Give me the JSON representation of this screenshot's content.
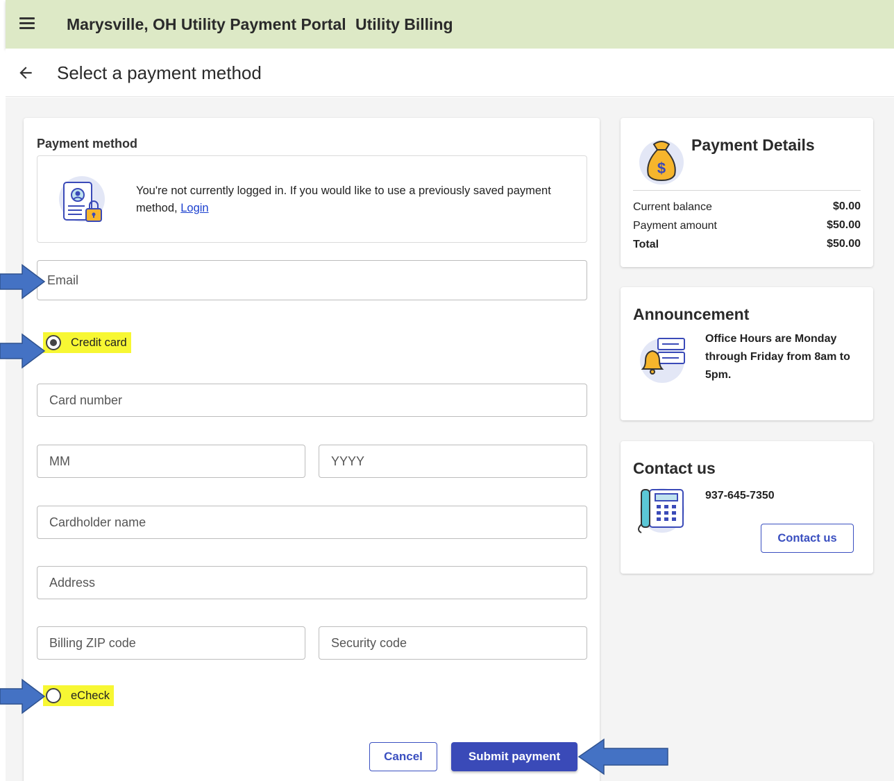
{
  "header": {
    "portal_title": "Marysville, OH Utility Payment Portal",
    "section_title": "Utility Billing"
  },
  "subheader": {
    "page_title": "Select a payment method"
  },
  "form": {
    "payment_method_label": "Payment method",
    "login_notice": "You're not currently logged in. If you would like to use a previously saved payment method,",
    "login_link": "Login",
    "email_placeholder": "Email",
    "credit_card_label": "Credit card",
    "credit_card_selected": true,
    "card_number_placeholder": "Card number",
    "month_placeholder": "MM",
    "year_placeholder": "YYYY",
    "cardholder_placeholder": "Cardholder name",
    "address_placeholder": "Address",
    "zip_placeholder": "Billing ZIP code",
    "security_placeholder": "Security code",
    "echeck_label": "eCheck",
    "echeck_selected": false,
    "cancel_label": "Cancel",
    "submit_label": "Submit payment"
  },
  "payment_details": {
    "title": "Payment Details",
    "rows": [
      {
        "label": "Current balance",
        "value": "$0.00"
      },
      {
        "label": "Payment amount",
        "value": "$50.00"
      },
      {
        "label": "Total",
        "value": "$50.00"
      }
    ]
  },
  "announcement": {
    "title": "Announcement",
    "text": "Office Hours are Monday through Friday from 8am to 5pm."
  },
  "contact": {
    "title": "Contact us",
    "phone": "937-645-7350",
    "button_label": "Contact us"
  },
  "colors": {
    "app_bar": "#dde9c6",
    "primary": "#3a4ab8",
    "highlight": "#f7f733",
    "annotation_arrow": "#4472c4"
  },
  "icons": [
    "menu-icon",
    "back-arrow-icon",
    "secure-login-icon",
    "money-bag-icon",
    "announcement-bell-icon",
    "phone-icon",
    "annotation-arrow-icon"
  ]
}
